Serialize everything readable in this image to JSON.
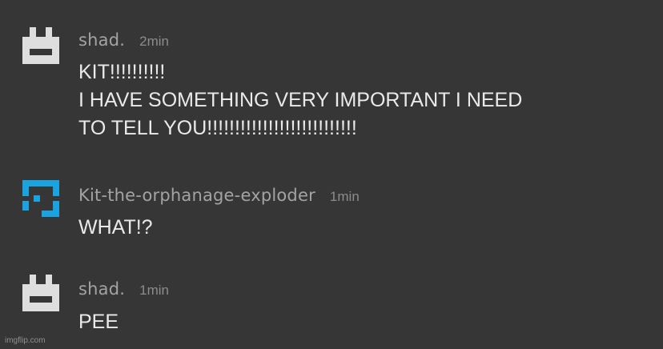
{
  "messages": [
    {
      "username": "shad.",
      "time": "2min",
      "avatar_icon": "robot-face-icon",
      "avatar_color": "#dedede",
      "lines": [
        "KIT!!!!!!!!!!",
        "I HAVE SOMETHING VERY IMPORTANT I NEED",
        "TO TELL YOU!!!!!!!!!!!!!!!!!!!!!!!!!!!"
      ]
    },
    {
      "username": "Kit-the-orphanage-exploder",
      "time": "1min",
      "avatar_icon": "pixel-glyph-icon",
      "avatar_color": "#1aa3de",
      "lines": [
        "WHAT!?"
      ]
    },
    {
      "username": "shad.",
      "time": "1min",
      "avatar_icon": "robot-face-icon",
      "avatar_color": "#dedede",
      "lines": [
        "PEE"
      ]
    }
  ],
  "watermark": "imgflip.com",
  "colors": {
    "background": "#363636",
    "username": "#a3a3a3",
    "timestamp": "#8c8c8c",
    "message_text": "#eaeaea"
  }
}
